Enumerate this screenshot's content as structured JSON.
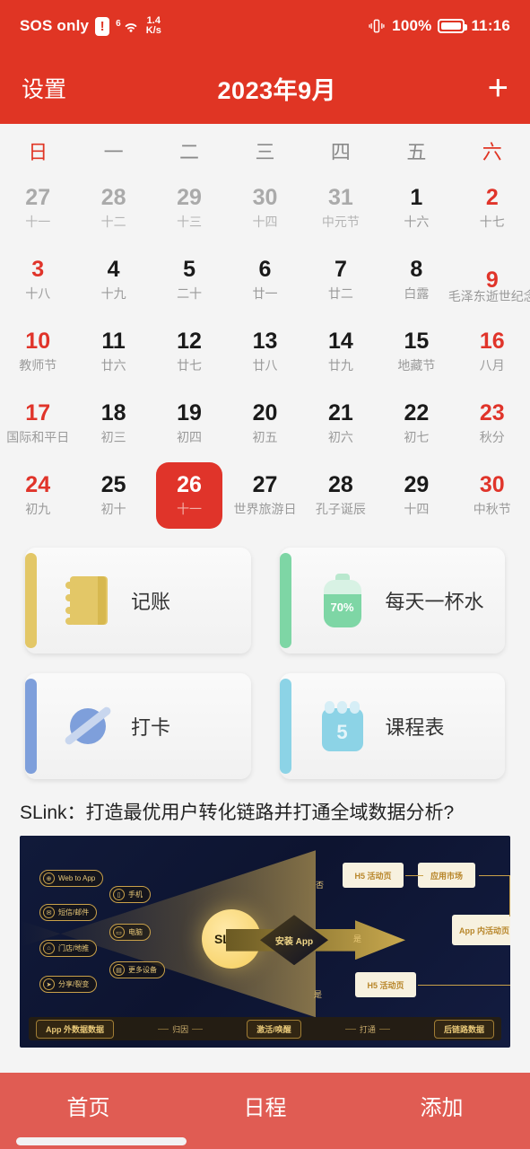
{
  "statusbar": {
    "carrier": "SOS only",
    "sim_icon": "sim-alert-icon",
    "wifi_gen": "6",
    "speed_value": "1.4",
    "speed_unit": "K/s",
    "vibrate_icon": "vibrate-icon",
    "battery_percent": "100%",
    "time": "11:16"
  },
  "header": {
    "settings_label": "设置",
    "title": "2023年9月",
    "add_label": "+"
  },
  "weekdays": [
    {
      "label": "日",
      "red": true
    },
    {
      "label": "一",
      "red": false
    },
    {
      "label": "二",
      "red": false
    },
    {
      "label": "三",
      "red": false
    },
    {
      "label": "四",
      "red": false
    },
    {
      "label": "五",
      "red": false
    },
    {
      "label": "六",
      "red": true
    }
  ],
  "calendar": {
    "days": [
      {
        "num": "27",
        "lunar": "十一",
        "style": "out"
      },
      {
        "num": "28",
        "lunar": "十二",
        "style": "out"
      },
      {
        "num": "29",
        "lunar": "十三",
        "style": "out"
      },
      {
        "num": "30",
        "lunar": "十四",
        "style": "out"
      },
      {
        "num": "31",
        "lunar": "中元节",
        "style": "out"
      },
      {
        "num": "1",
        "lunar": "十六",
        "style": "normal"
      },
      {
        "num": "2",
        "lunar": "十七",
        "style": "red"
      },
      {
        "num": "3",
        "lunar": "十八",
        "style": "red"
      },
      {
        "num": "4",
        "lunar": "十九",
        "style": "normal"
      },
      {
        "num": "5",
        "lunar": "二十",
        "style": "normal"
      },
      {
        "num": "6",
        "lunar": "廿一",
        "style": "normal"
      },
      {
        "num": "7",
        "lunar": "廿二",
        "style": "normal"
      },
      {
        "num": "8",
        "lunar": "白露",
        "style": "normal"
      },
      {
        "num": "9",
        "lunar": "毛泽东逝世纪念",
        "style": "red",
        "overflow": true
      },
      {
        "num": "10",
        "lunar": "教师节",
        "style": "red"
      },
      {
        "num": "11",
        "lunar": "廿六",
        "style": "normal"
      },
      {
        "num": "12",
        "lunar": "廿七",
        "style": "normal"
      },
      {
        "num": "13",
        "lunar": "廿八",
        "style": "normal"
      },
      {
        "num": "14",
        "lunar": "廿九",
        "style": "normal"
      },
      {
        "num": "15",
        "lunar": "地藏节",
        "style": "normal"
      },
      {
        "num": "16",
        "lunar": "八月",
        "style": "red"
      },
      {
        "num": "17",
        "lunar": "国际和平日",
        "style": "red"
      },
      {
        "num": "18",
        "lunar": "初三",
        "style": "normal"
      },
      {
        "num": "19",
        "lunar": "初四",
        "style": "normal"
      },
      {
        "num": "20",
        "lunar": "初五",
        "style": "normal"
      },
      {
        "num": "21",
        "lunar": "初六",
        "style": "normal"
      },
      {
        "num": "22",
        "lunar": "初七",
        "style": "normal"
      },
      {
        "num": "23",
        "lunar": "秋分",
        "style": "red"
      },
      {
        "num": "24",
        "lunar": "初九",
        "style": "red"
      },
      {
        "num": "25",
        "lunar": "初十",
        "style": "normal"
      },
      {
        "num": "26",
        "lunar": "十一",
        "style": "selected"
      },
      {
        "num": "27",
        "lunar": "世界旅游日",
        "style": "normal"
      },
      {
        "num": "28",
        "lunar": "孔子诞辰",
        "style": "normal"
      },
      {
        "num": "29",
        "lunar": "十四",
        "style": "normal"
      },
      {
        "num": "30",
        "lunar": "中秋节",
        "style": "red"
      }
    ],
    "selected_day": "26"
  },
  "cards": [
    {
      "label": "记账",
      "icon": "notebook-icon",
      "accent": "#E3C767"
    },
    {
      "label": "每天一杯水",
      "icon": "water-bottle-icon",
      "accent": "#7ED6A5",
      "value": "70%"
    },
    {
      "label": "打卡",
      "icon": "planet-icon",
      "accent": "#7E9FDB"
    },
    {
      "label": "课程表",
      "icon": "calendar-icon",
      "accent": "#8CD3E6",
      "value": "5"
    }
  ],
  "ad": {
    "title": "SLink：打造最优用户转化链路并打通全域数据分析?",
    "diagram": {
      "hub": "SLink",
      "sources": [
        "Web to App",
        "短信/邮件",
        "门店/地推",
        "分享/裂变"
      ],
      "devices": [
        "手机",
        "电脑",
        "更多设备"
      ],
      "decision": "安装 App",
      "branch_no": "否",
      "branch_yes_top": "是",
      "branch_yes_bottom": "是",
      "node_h5_top": "H5 活动页",
      "node_market": "应用市场",
      "node_inapp": "App 内活动页",
      "node_h5_bottom": "H5 活动页",
      "footer_chips": [
        "App 外数据数据",
        "激活/唤醒",
        "后链路数据"
      ],
      "footer_labels": [
        "归因",
        "打通"
      ]
    }
  },
  "bottomnav": {
    "items": [
      {
        "label": "首页"
      },
      {
        "label": "日程"
      },
      {
        "label": "添加"
      }
    ]
  }
}
